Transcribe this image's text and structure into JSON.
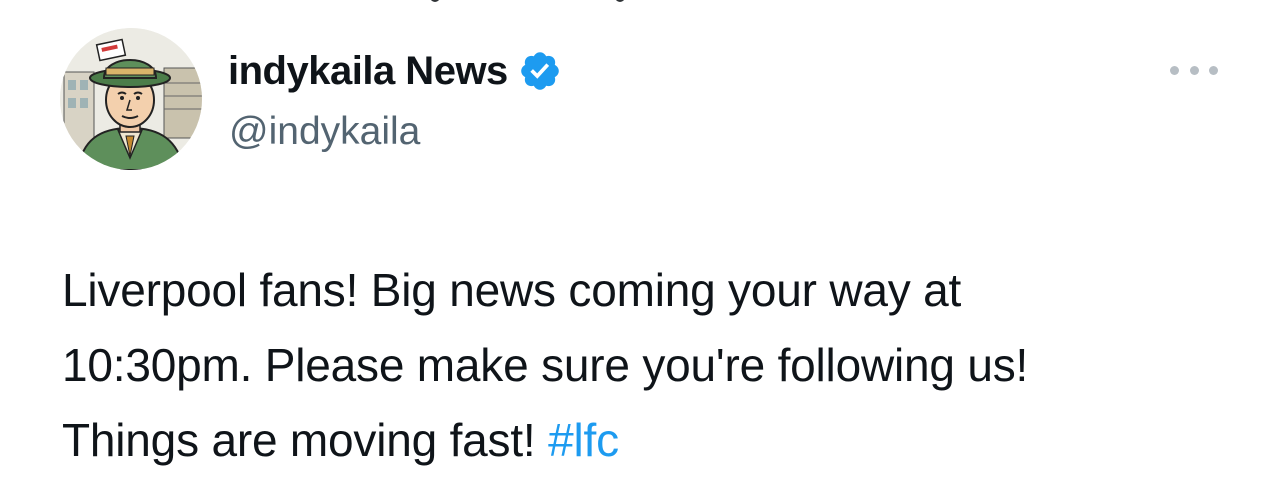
{
  "author": {
    "display_name": "indykaila News",
    "handle": "@indykaila",
    "verified": true,
    "verified_color": "#1d9bf0"
  },
  "tweet": {
    "line1": "Liverpool fans! Big news coming your way at",
    "line2": "10:30pm. Please make sure you're following us!",
    "line3_text": "Things are moving fast! ",
    "hashtag": "#lfc"
  },
  "colors": {
    "text": "#0f1419",
    "secondary": "#536471",
    "link": "#1d9bf0",
    "more_dots": "#b7bec4"
  },
  "icons": {
    "verified": "verified-badge-icon",
    "more": "more-options-icon"
  }
}
